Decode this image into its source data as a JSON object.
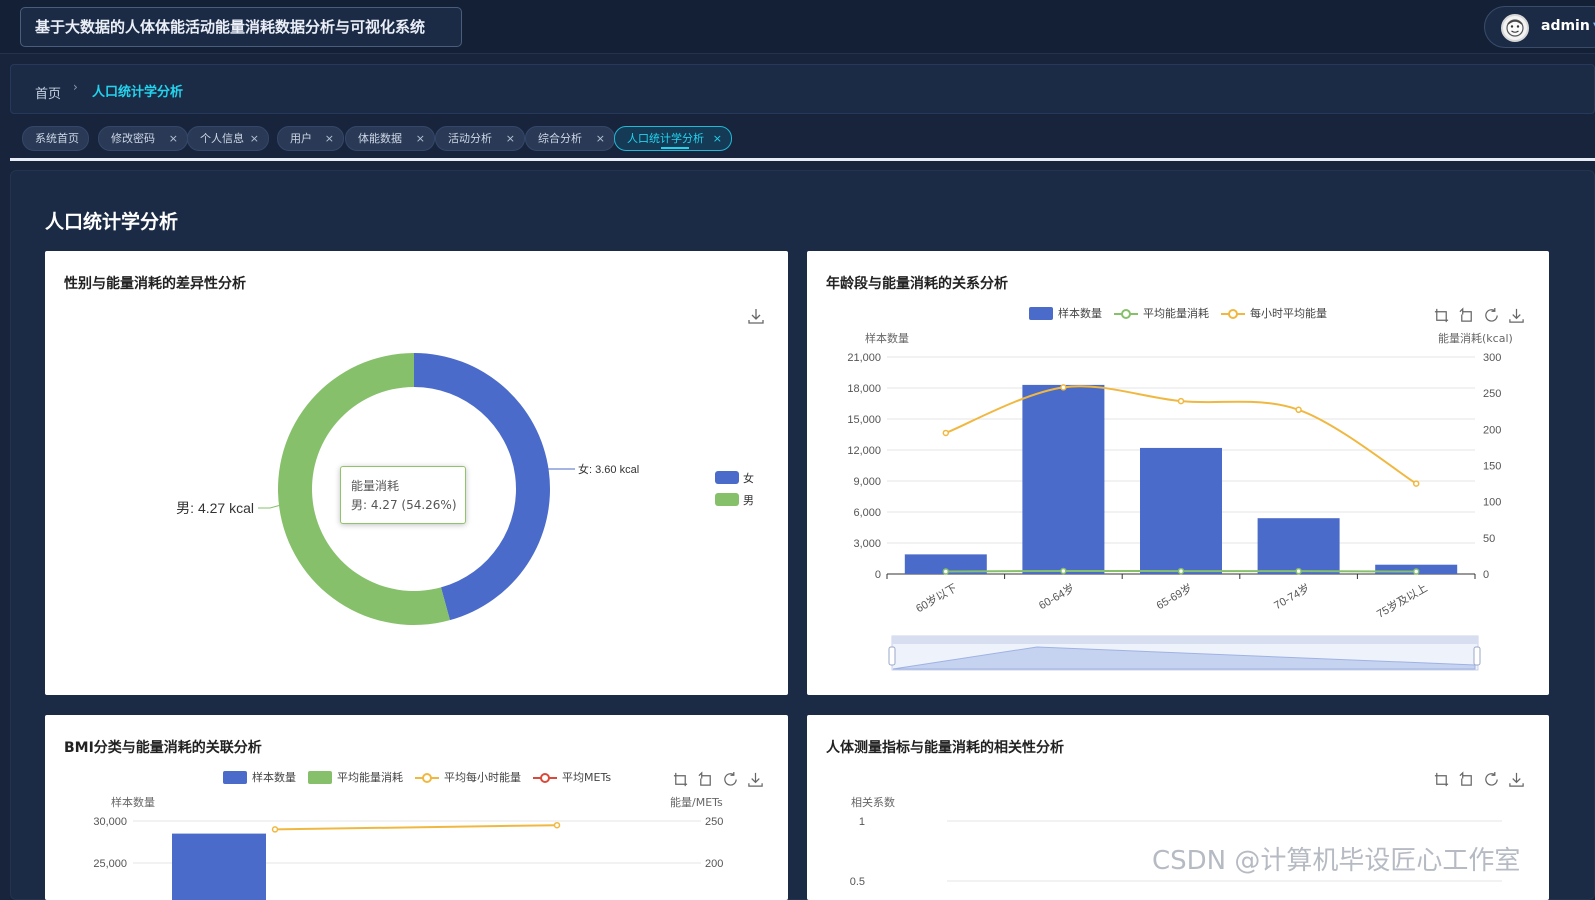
{
  "app": {
    "title": "基于大数据的人体体能活动能量消耗数据分析与可视化系统"
  },
  "user": {
    "name": "admin"
  },
  "breadcrumb": {
    "home": "首页",
    "current": "人口统计学分析"
  },
  "tabs": [
    {
      "label": "系统首页",
      "closable": false
    },
    {
      "label": "修改密码",
      "closable": true
    },
    {
      "label": "个人信息",
      "closable": true
    },
    {
      "label": "用户",
      "closable": true
    },
    {
      "label": "体能数据",
      "closable": true
    },
    {
      "label": "活动分析",
      "closable": true
    },
    {
      "label": "综合分析",
      "closable": true
    },
    {
      "label": "人口统计学分析",
      "closable": true,
      "active": true
    }
  ],
  "close_glyph": "×",
  "page": {
    "title": "人口统计学分析"
  },
  "colors": {
    "blue": "#4a6bc9",
    "green": "#86c06b",
    "yellow": "#f0b840",
    "red": "#d94a3a",
    "accent": "#22d3ee"
  },
  "charts": {
    "gender": {
      "title": "性别与能量消耗的差异性分析",
      "slice_labels": {
        "female": "女: 3.60 kcal",
        "male": "男: 4.27 kcal"
      },
      "legend": [
        "女",
        "男"
      ],
      "tooltip": {
        "title": "能量消耗",
        "value": "男: 4.27 (54.26%)"
      }
    },
    "age": {
      "title": "年龄段与能量消耗的关系分析",
      "legend": [
        "样本数量",
        "平均能量消耗",
        "每小时平均能量"
      ],
      "yleft_name": "样本数量",
      "yright_name": "能量消耗(kcal)",
      "yleft_ticks": [
        "21,000",
        "18,000",
        "15,000",
        "12,000",
        "9,000",
        "6,000",
        "3,000",
        "0"
      ],
      "yright_ticks": [
        "300",
        "250",
        "200",
        "150",
        "100",
        "50",
        "0"
      ]
    },
    "bmi": {
      "title": "BMI分类与能量消耗的关联分析",
      "legend": [
        "样本数量",
        "平均能量消耗",
        "平均每小时能量",
        "平均METs"
      ],
      "yleft_name": "样本数量",
      "yright_name": "能量/METs",
      "yleft_ticks": [
        "30,000",
        "25,000"
      ],
      "yright_ticks": [
        "250",
        "200"
      ]
    },
    "body": {
      "title": "人体测量指标与能量消耗的相关性分析",
      "y_name": "相关系数",
      "y_ticks": [
        "1",
        "0.5"
      ]
    }
  },
  "chart_data": [
    {
      "type": "pie",
      "title": "性别与能量消耗的差异性分析",
      "categories": [
        "女",
        "男"
      ],
      "values": [
        3.6,
        4.27
      ],
      "unit": "kcal",
      "donut": true,
      "legend_position": "right"
    },
    {
      "type": "bar",
      "title": "年龄段与能量消耗的关系分析",
      "categories": [
        "60岁以下",
        "60-64岁",
        "65-69岁",
        "70-74岁",
        "75岁及以上"
      ],
      "series": [
        {
          "name": "样本数量",
          "type": "bar",
          "axis": "left",
          "values": [
            1900,
            18300,
            12200,
            5400,
            900
          ]
        },
        {
          "name": "平均能量消耗",
          "type": "line",
          "axis": "right",
          "values": [
            3.5,
            4.2,
            4.0,
            3.9,
            3.4
          ]
        },
        {
          "name": "每小时平均能量",
          "type": "line",
          "axis": "right",
          "smooth": true,
          "values": [
            195,
            258,
            239,
            227,
            125
          ]
        }
      ],
      "ylim_left": [
        0,
        21000
      ],
      "ylim_right": [
        0,
        300
      ],
      "grid": true,
      "legend_position": "top",
      "datazoom": true
    },
    {
      "type": "bar",
      "title": "BMI分类与能量消耗的关联分析",
      "categories": [
        "",
        ""
      ],
      "series": [
        {
          "name": "样本数量",
          "type": "bar",
          "axis": "left",
          "values": [
            28500,
            null
          ]
        },
        {
          "name": "平均能量消耗",
          "type": "bar",
          "axis": "left",
          "values": [
            null,
            null
          ]
        },
        {
          "name": "平均每小时能量",
          "type": "line",
          "axis": "right",
          "values": [
            240,
            245
          ]
        },
        {
          "name": "平均METs",
          "type": "line",
          "axis": "right",
          "values": [
            null,
            null
          ]
        }
      ],
      "ylim_left_visible": [
        25000,
        30000
      ],
      "ylim_right_visible": [
        200,
        250
      ],
      "legend_position": "top"
    },
    {
      "type": "line",
      "title": "人体测量指标与能量消耗的相关性分析",
      "y_ticks_visible": [
        1,
        0.5
      ],
      "ylabel": "相关系数"
    }
  ],
  "watermark": "CSDN @计算机毕设匠心工作室"
}
